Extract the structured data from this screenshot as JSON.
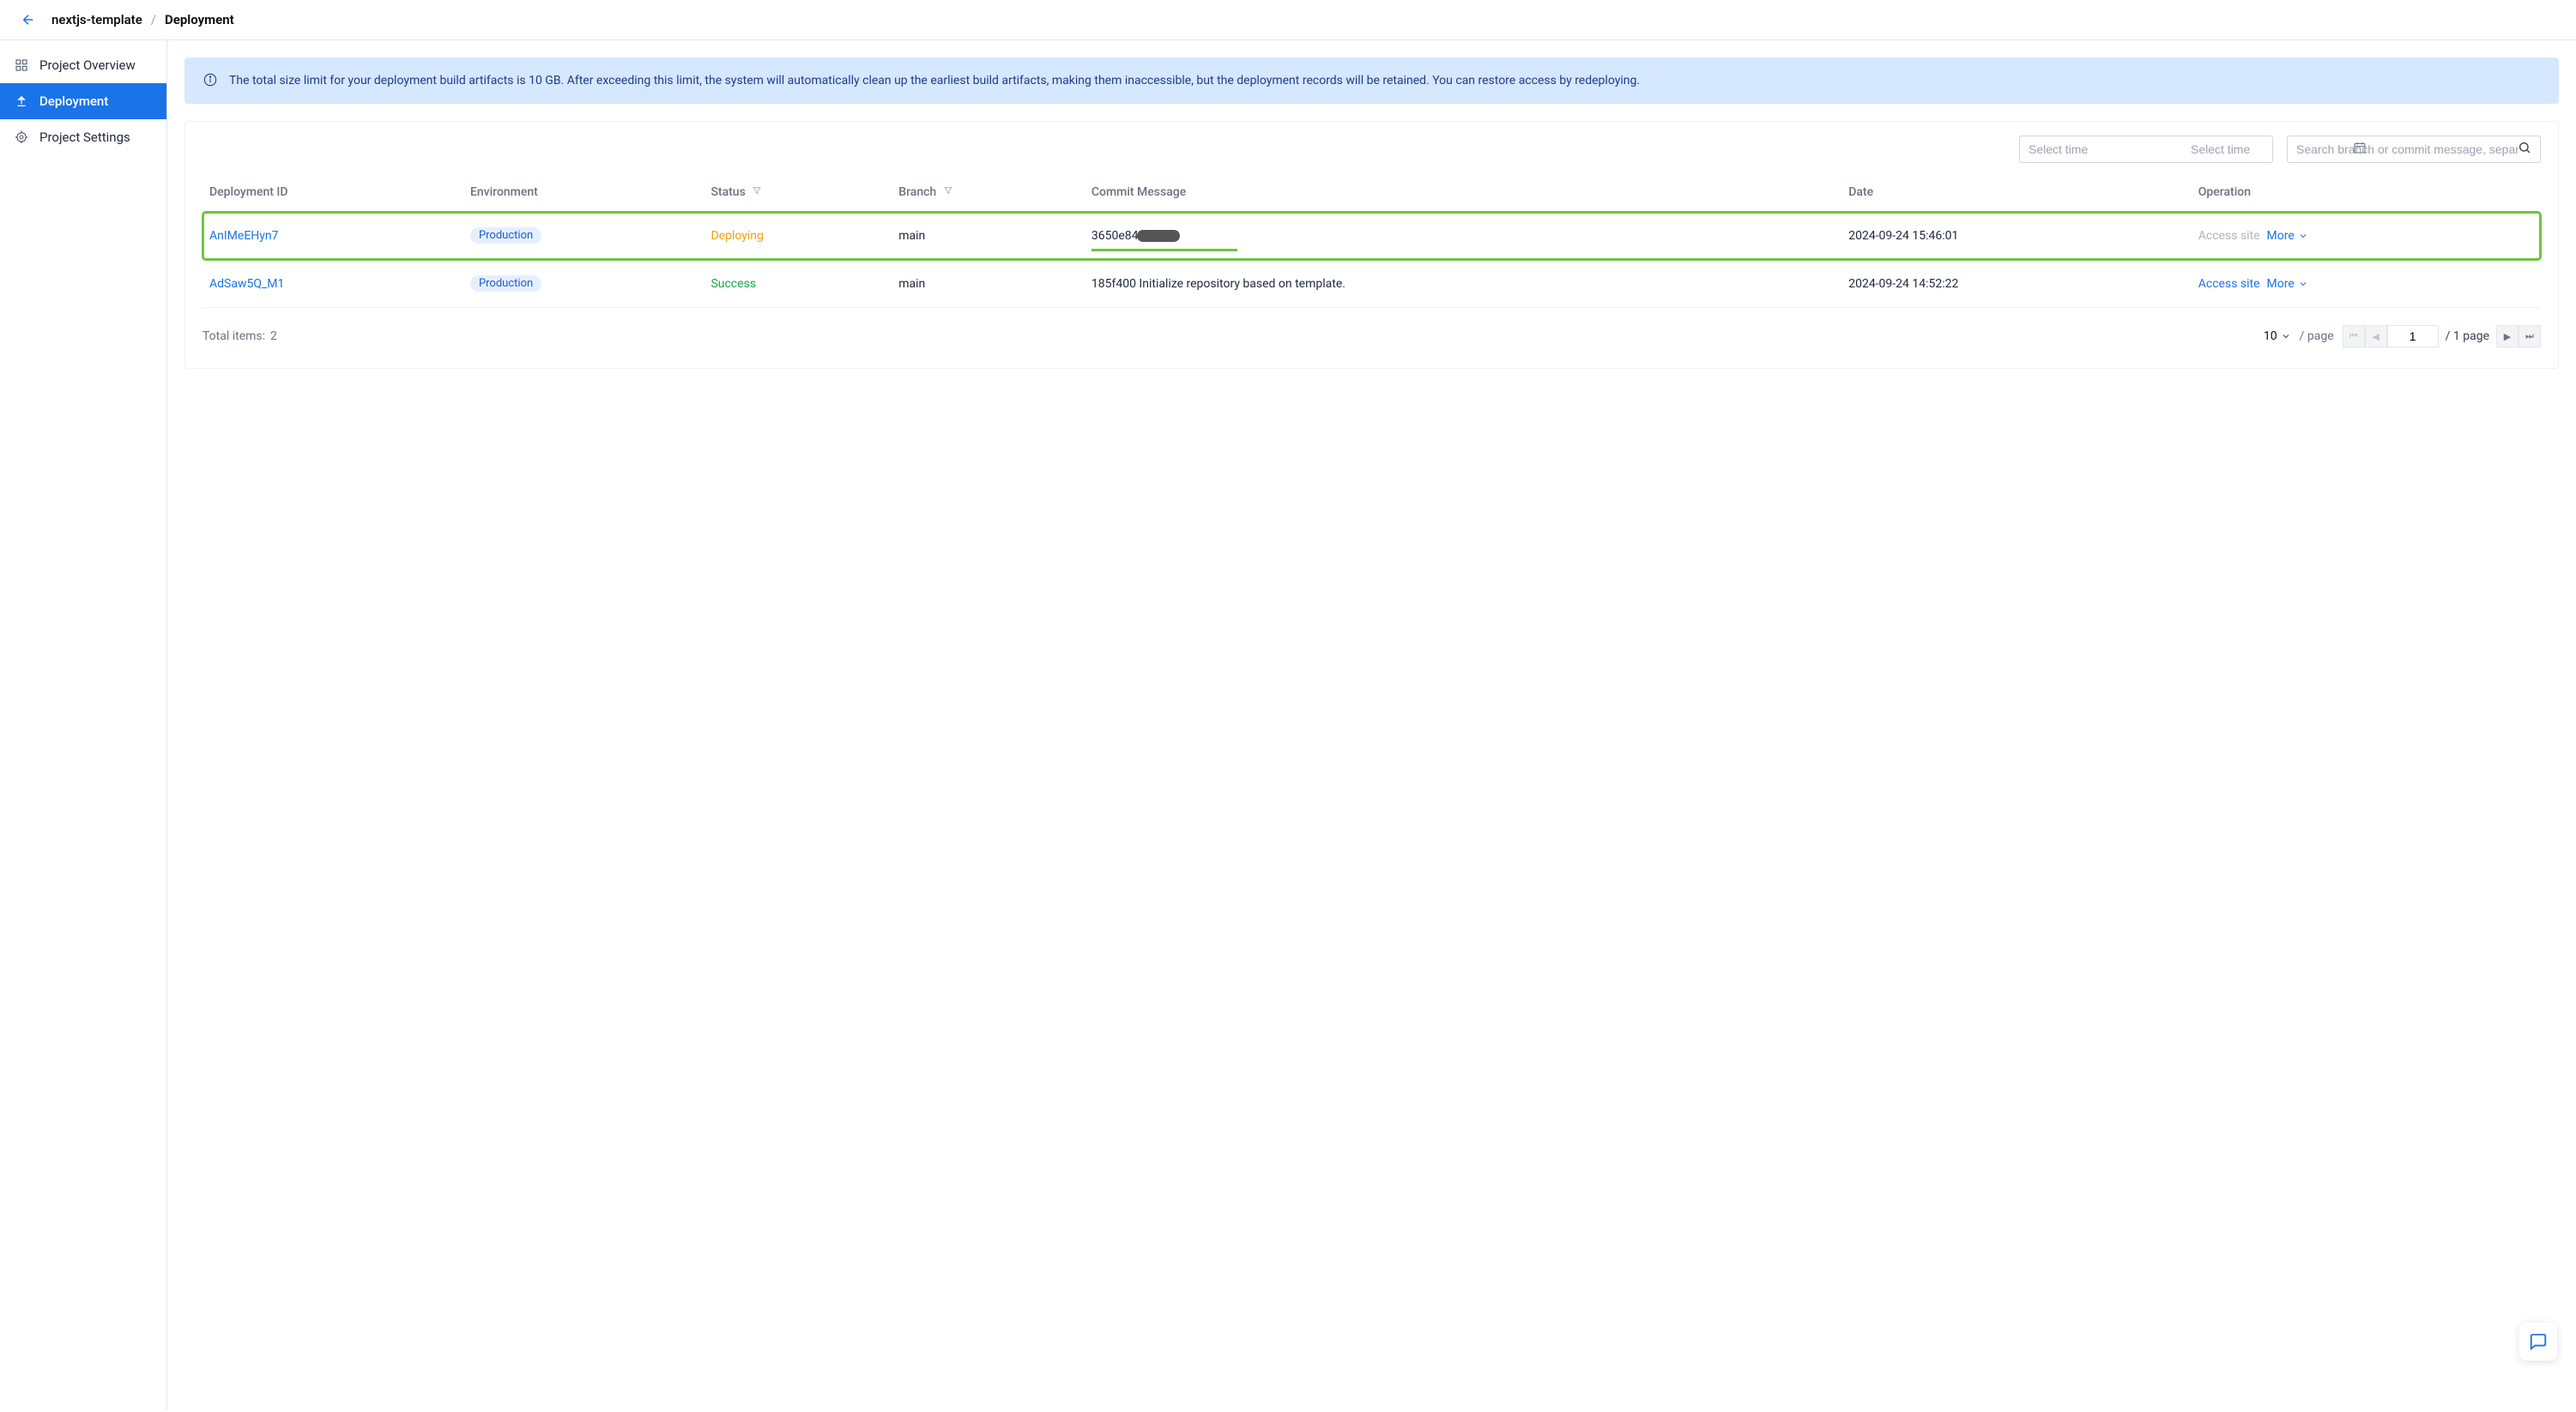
{
  "header": {
    "project": "nextjs-template",
    "page": "Deployment"
  },
  "sidebar": {
    "items": [
      {
        "label": "Project Overview"
      },
      {
        "label": "Deployment"
      },
      {
        "label": "Project Settings"
      }
    ]
  },
  "banner": {
    "message": "The total size limit for your deployment build artifacts is 10 GB. After exceeding this limit, the system will automatically clean up the earliest build artifacts, making them inaccessible, but the deployment records will be retained. You can restore access by redeploying."
  },
  "toolbar": {
    "date_from_placeholder": "Select time",
    "date_to_placeholder": "Select time",
    "search_placeholder": "Search branch or commit message, separate m"
  },
  "table": {
    "columns": {
      "deployment_id": "Deployment ID",
      "environment": "Environment",
      "status": "Status",
      "branch": "Branch",
      "commit_message": "Commit Message",
      "date": "Date",
      "operation": "Operation"
    },
    "rows": [
      {
        "id": "AnIMeEHyn7",
        "environment": "Production",
        "status": "Deploying",
        "status_class": "deploying",
        "branch": "main",
        "commit_hash": "3650e84",
        "commit_redacted": true,
        "commit_underline": true,
        "date": "2024-09-24 15:46:01",
        "access_label": "Access site",
        "access_enabled": false,
        "more_label": "More",
        "highlight": true
      },
      {
        "id": "AdSaw5Q_M1",
        "environment": "Production",
        "status": "Success",
        "status_class": "success",
        "branch": "main",
        "commit_hash": "185f400",
        "commit_text": "Initialize repository based on template.",
        "date": "2024-09-24 14:52:22",
        "access_label": "Access site",
        "access_enabled": true,
        "more_label": "More"
      }
    ]
  },
  "footer": {
    "total_label": "Total items:",
    "total_count": "2",
    "page_size": "10",
    "per_page_label": "/ page",
    "current_page": "1",
    "total_pages_label": "/ 1 page"
  }
}
